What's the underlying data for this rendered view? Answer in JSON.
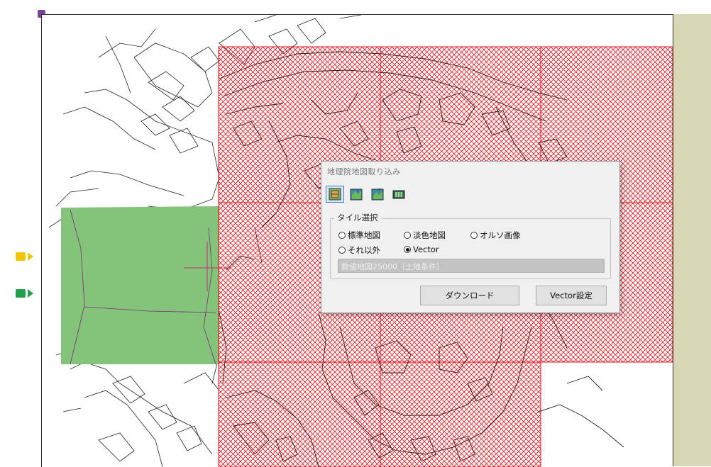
{
  "dialog": {
    "title": "地理院地図取り込み",
    "toolbar": [
      {
        "icon": "map-tile-icon",
        "active": true
      },
      {
        "icon": "map-import-icon",
        "active": false
      },
      {
        "icon": "map-export-icon",
        "active": false
      },
      {
        "icon": "film-strip-icon",
        "active": false
      }
    ],
    "group_label": "タイル選択",
    "radio_options": [
      {
        "label": "標準地図",
        "checked": false
      },
      {
        "label": "淡色地図",
        "checked": false
      },
      {
        "label": "オルソ画像",
        "checked": false
      },
      {
        "label": "それ以外",
        "checked": false
      },
      {
        "label": "Vector",
        "checked": true
      }
    ],
    "layer_field_value": "数値地図25000（土地条件）",
    "download_label": "ダウンロード",
    "vector_settings_label": "Vector設定"
  },
  "markers": [
    {
      "name": "yellow-marker",
      "color": "#f2c500"
    },
    {
      "name": "green-marker",
      "color": "#22a04b"
    }
  ],
  "colors": {
    "hatch_red": "#e3121b",
    "selected_area_green": "#84c47a",
    "side_strip": "#d9d8b4",
    "handle_purple": "#7b3f9e",
    "parcel_lines": "#222222"
  }
}
